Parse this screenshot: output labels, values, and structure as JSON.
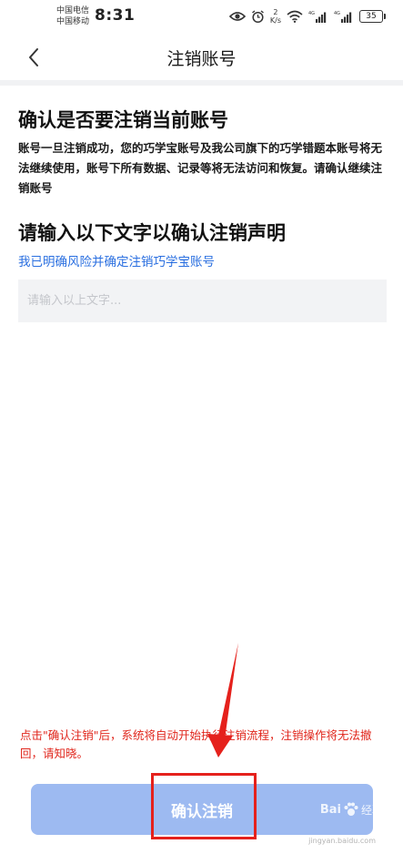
{
  "status_bar": {
    "carrier_1": "中国电信",
    "carrier_2": "中国移动",
    "time": "8:31",
    "net_speed_value": "2",
    "net_speed_unit": "K/s",
    "signal_1_label": "4G",
    "signal_2_label": "4G",
    "battery_level": "35"
  },
  "nav": {
    "title": "注销账号"
  },
  "section_confirm": {
    "title": "确认是否要注销当前账号",
    "description": "账号一旦注销成功，您的巧学宝账号及我公司旗下的巧学错题本账号将无法继续使用，账号下所有数据、记录等将无法访问和恢复。请确认继续注销账号"
  },
  "section_input": {
    "title": "请输入以下文字以确认注销声明",
    "confirm_phrase": "我已明确风险并确定注销巧学宝账号",
    "input_value": "",
    "input_placeholder": "请输入以上文字..."
  },
  "warning": {
    "text": "点击\"确认注销\"后，系统将自动开始执行注销流程，注销操作将无法撤回，请知晓。"
  },
  "actions": {
    "confirm_label": "确认注销"
  },
  "watermark": {
    "brand": "Bai",
    "brand_suffix": "经验",
    "url": "jingyan.baidu.com"
  },
  "colors": {
    "accent_link": "#2a6fe0",
    "button_disabled": "#9dbaf1",
    "warning_red": "#e0251b",
    "annotation_red": "#e5211c"
  },
  "icons": {
    "back": "chevron-left-icon",
    "eye": "eye-icon",
    "alarm": "alarm-icon",
    "wifi": "wifi-icon",
    "signal": "signal-bars-icon",
    "battery": "battery-icon",
    "watermark_paw": "paw-icon"
  }
}
